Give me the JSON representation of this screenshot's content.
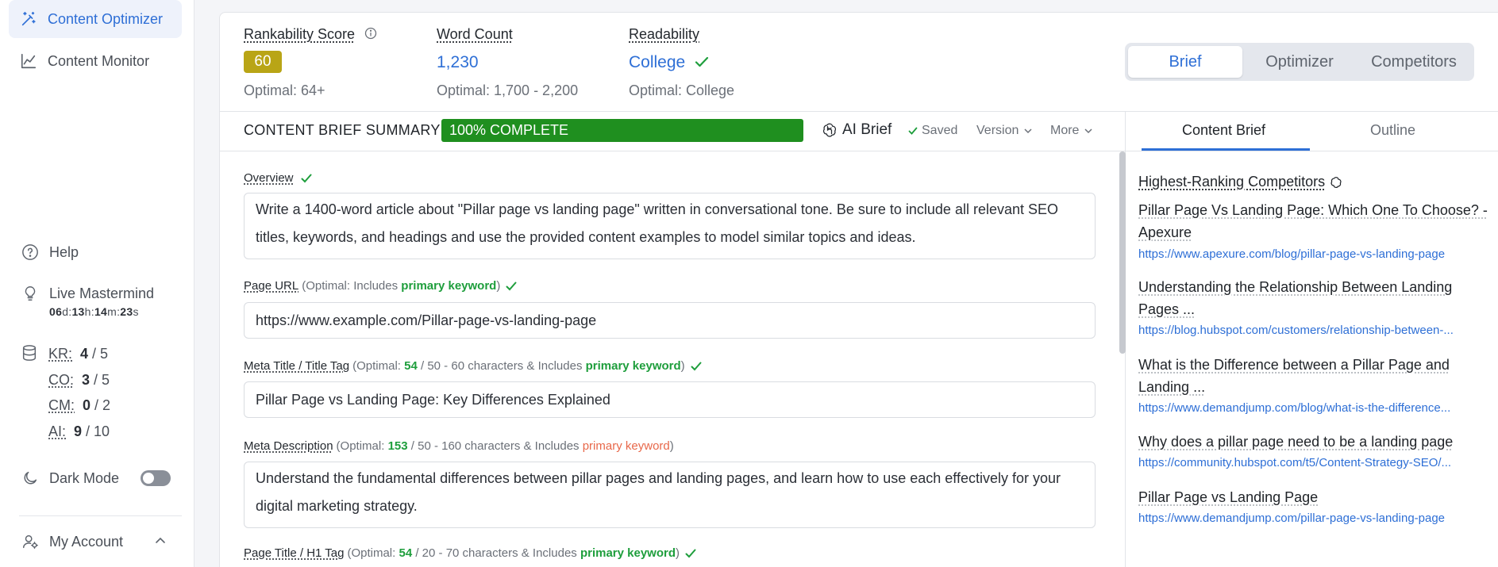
{
  "sidebar": {
    "nav": [
      {
        "label": "Content Optimizer",
        "icon": "magic-wand-icon",
        "active": true
      },
      {
        "label": "Content Monitor",
        "icon": "line-chart-icon",
        "active": false
      }
    ],
    "help_label": "Help",
    "mastermind": {
      "label": "Live Mastermind",
      "days": "06",
      "d": "d:",
      "hours": "13",
      "h": "h:",
      "minutes": "14",
      "m": "m:",
      "seconds": "23",
      "s": "s"
    },
    "quotas": [
      {
        "label": "KR:",
        "used": "4",
        "total": "/ 5"
      },
      {
        "label": "CO:",
        "used": "3",
        "total": "/ 5"
      },
      {
        "label": "CM:",
        "used": "0",
        "total": "/ 2"
      },
      {
        "label": "AI:",
        "used": "9",
        "total": "/ 10"
      }
    ],
    "dark_mode_label": "Dark Mode",
    "dark_mode_on": false,
    "account_label": "My Account"
  },
  "metrics": {
    "rankability": {
      "label": "Rankability Score",
      "value": "60",
      "optimal": "Optimal: 64+"
    },
    "word_count": {
      "label": "Word Count",
      "value": "1,230",
      "optimal": "Optimal: 1,700 - 2,200"
    },
    "readability": {
      "label": "Readability",
      "value": "College",
      "optimal": "Optimal: College"
    }
  },
  "view_tabs": [
    "Brief",
    "Optimizer",
    "Competitors"
  ],
  "active_view": "Brief",
  "summary": {
    "title": "CONTENT BRIEF SUMMARY",
    "progress_label": "100% COMPLETE",
    "progress": 1.0,
    "ai_brief_label": "AI Brief",
    "saved_label": "Saved",
    "version_label": "Version",
    "more_label": "More"
  },
  "form": {
    "overview": {
      "label": "Overview",
      "value": "Write a 1400-word article about \"Pillar page vs landing page\" written in conversational tone. Be sure to include all relevant SEO titles, keywords, and headings and use the provided content examples to model similar topics and ideas."
    },
    "page_url": {
      "label": "Page URL",
      "hint_prefix": "(Optimal: Includes",
      "keyword": "primary keyword",
      "hint_suffix": ")",
      "value": "https://www.example.com/Pillar-page-vs-landing-page"
    },
    "meta_title": {
      "label": "Meta Title / Title Tag",
      "hint_prefix": "(Optimal:",
      "count": "54",
      "hint_mid": "/ 50 - 60 characters & Includes",
      "keyword": "primary keyword",
      "hint_suffix": ")",
      "value": "Pillar Page vs Landing Page: Key Differences Explained"
    },
    "meta_description": {
      "label": "Meta Description",
      "hint_prefix": "(Optimal:",
      "count": "153",
      "hint_mid": "/ 50 - 160 characters & Includes",
      "keyword": "primary keyword",
      "hint_suffix": ")",
      "value": "Understand the fundamental differences between pillar pages and landing pages, and learn how to use each effectively for your digital marketing strategy."
    },
    "page_title": {
      "label": "Page Title / H1 Tag",
      "hint_prefix": "(Optimal:",
      "count": "54",
      "hint_mid": "/ 20 - 70 characters & Includes",
      "keyword": "primary keyword",
      "hint_suffix": ")"
    }
  },
  "right_panel": {
    "tabs": [
      "Content Brief",
      "Outline"
    ],
    "active_tab": "Content Brief",
    "competitors_heading": "Highest-Ranking Competitors",
    "competitors": [
      {
        "title": "Pillar Page Vs Landing Page: Which One To Choose? - Apexure",
        "url": "https://www.apexure.com/blog/pillar-page-vs-landing-page"
      },
      {
        "title": "Understanding the Relationship Between Landing Pages ...",
        "url": "https://blog.hubspot.com/customers/relationship-between-..."
      },
      {
        "title": "What is the Difference between a Pillar Page and Landing ...",
        "url": "https://www.demandjump.com/blog/what-is-the-difference..."
      },
      {
        "title": "Why does a pillar page need to be a landing page",
        "url": "https://community.hubspot.com/t5/Content-Strategy-SEO/..."
      },
      {
        "title": "Pillar Page vs Landing Page",
        "url": "https://www.demandjump.com/pillar-page-vs-landing-page"
      }
    ]
  },
  "colors": {
    "accent": "#2e6fd6",
    "score_badge": "#b9a516",
    "progress_green": "#1f8f1f",
    "ok_green": "#1e9e3c",
    "warn_red": "#e8684a"
  }
}
